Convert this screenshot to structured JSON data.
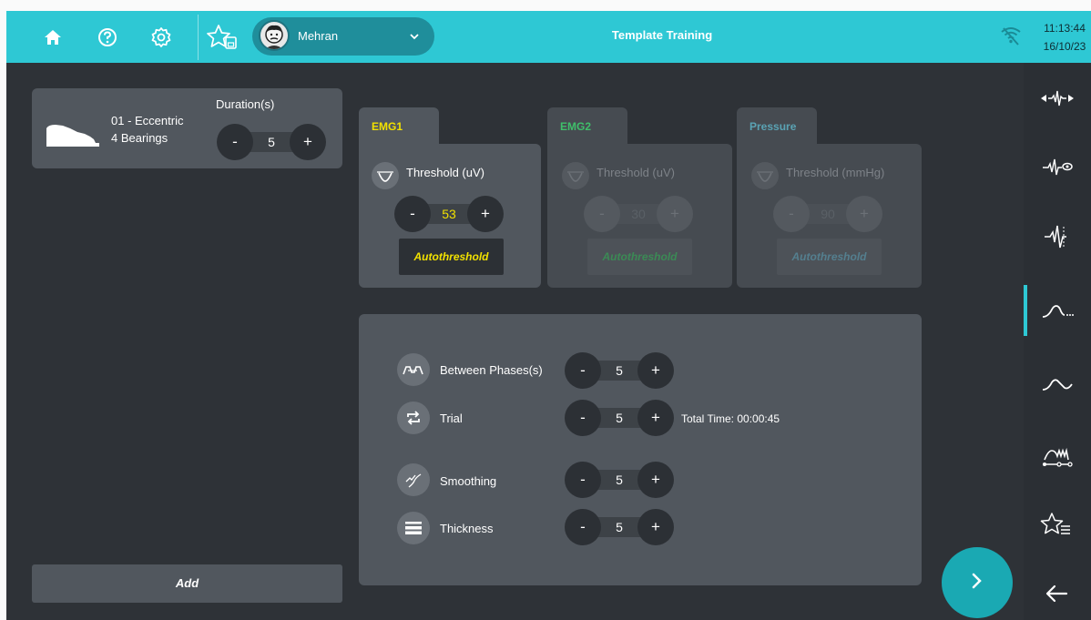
{
  "header": {
    "user_name": "Mehran",
    "title": "Template Training",
    "time": "11:13:44",
    "date": "16/10/23",
    "icons": [
      "home-icon",
      "help-icon",
      "settings-icon",
      "favorite-save-icon",
      "chevron-down-icon",
      "wifi-off-icon"
    ]
  },
  "phase": {
    "name": "01 - Eccentric",
    "subtitle": "4 Bearings",
    "duration_label": "Duration(s)",
    "duration": "5",
    "minus": "-",
    "plus": "+"
  },
  "add_label": "Add",
  "sensors": [
    {
      "tab": "EMG1",
      "threshold_label": "Threshold (uV)",
      "value": "53",
      "auto_label": "Autothreshold",
      "active": true
    },
    {
      "tab": "EMG2",
      "threshold_label": "Threshold (uV)",
      "value": "30",
      "auto_label": "Autothreshold",
      "active": false
    },
    {
      "tab": "Pressure",
      "threshold_label": "Threshold (mmHg)",
      "value": "90",
      "auto_label": "Autothreshold",
      "active": false
    }
  ],
  "settings": {
    "between_phases": {
      "label": "Between Phases(s)",
      "value": "5"
    },
    "trial": {
      "label": "Trial",
      "value": "5"
    },
    "total_time": "Total Time: 00:00:45",
    "smoothing": {
      "label": "Smoothing",
      "value": "5"
    },
    "thickness": {
      "label": "Thickness",
      "value": "5"
    }
  },
  "sidebar": {
    "items": [
      "emg-trigger-icon",
      "emg-monitor-icon",
      "emg-signal-icon",
      "template-icon",
      "curve-icon",
      "multi-phase-icon",
      "favorites-list-icon",
      "back-arrow-icon"
    ],
    "active_index": 3
  },
  "colors": {
    "accent": "#2ec8d4",
    "emg1_text": "#f1e000",
    "emg2_text": "#3fbf6a",
    "pressure_text": "#5aa3b4",
    "panel": "#51575e",
    "background": "#2e3237"
  }
}
